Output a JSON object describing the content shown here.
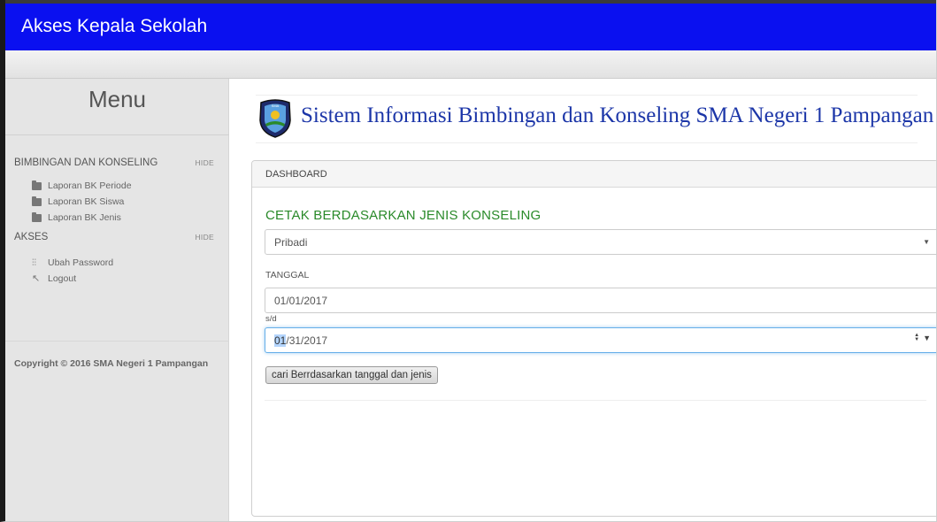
{
  "header": {
    "brand": "Akses Kepala Sekolah"
  },
  "sidebar": {
    "menu_title": "Menu",
    "sections": [
      {
        "label": "BIMBINGAN DAN KONSELING",
        "hide_label": "HIDE",
        "items": [
          {
            "label": "Laporan BK Periode",
            "icon": "folder-icon"
          },
          {
            "label": "Laporan BK Siswa",
            "icon": "folder-icon"
          },
          {
            "label": "Laporan BK Jenis",
            "icon": "folder-icon"
          }
        ]
      },
      {
        "label": "AKSES",
        "hide_label": "HIDE",
        "items": [
          {
            "label": "Ubah Password",
            "icon": "sliders-icon"
          },
          {
            "label": "Logout",
            "icon": "arrow-icon"
          }
        ]
      }
    ],
    "copyright": "Copyright © 2016 SMA Negeri 1 Pampangan"
  },
  "main": {
    "site_title": "Sistem Informasi Bimbingan dan Konseling SMA Negeri 1 Pampangan",
    "panel": {
      "heading": "DASHBOARD",
      "section_title": "CETAK BERDASARKAN JENIS KONSELING",
      "jenis_select": {
        "value": "Pribadi"
      },
      "tanggal_label": "TANGGAL",
      "date_from": "01/01/2017",
      "sd_label": "s/d",
      "date_to_selected": "01",
      "date_to_rest": "/31/2017",
      "search_button": "cari Berrdasarkan tanggal dan jenis"
    }
  }
}
